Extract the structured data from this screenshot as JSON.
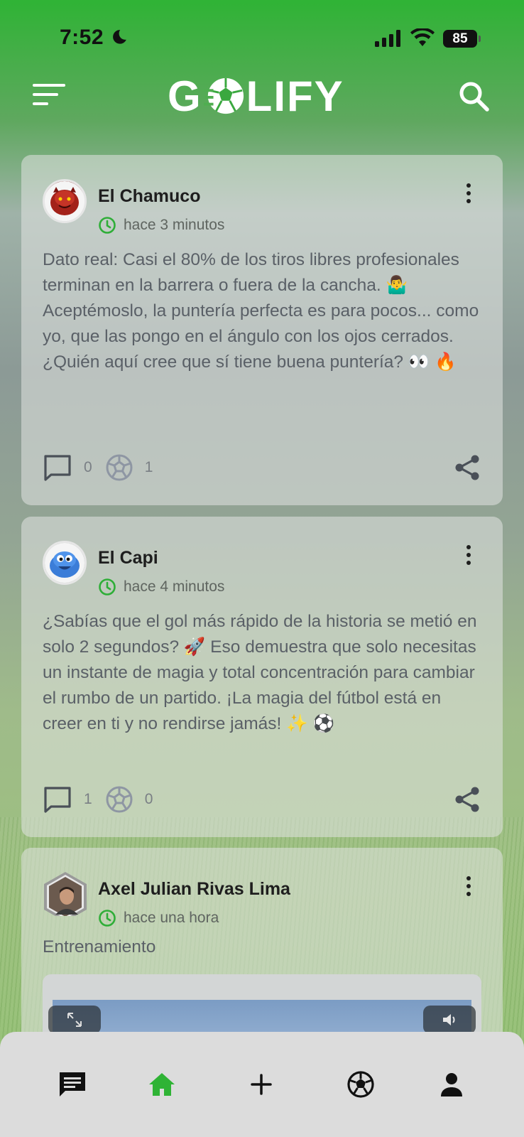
{
  "status_bar": {
    "time": "7:52",
    "battery": "85"
  },
  "app": {
    "logo_text_left": "G",
    "logo_text_right": "LIFY",
    "brand_color": "#2fb335"
  },
  "posts": [
    {
      "author": "El Chamuco",
      "time_ago": "hace 3 minutos",
      "text": "Dato real: Casi el 80% de los tiros libres profesionales terminan en la barrera o fuera de la cancha. 🤷‍♂️  Aceptémoslo, la puntería perfecta es para pocos... como yo, que las pongo en el ángulo con los ojos cerrados. ¿Quién aquí cree que sí tiene buena puntería? 👀 🔥",
      "comments": "0",
      "balls": "1"
    },
    {
      "author": "El Capi",
      "time_ago": "hace 4 minutos",
      "text": "¿Sabías que el gol más rápido de la historia se metió en solo 2 segundos? 🚀 Eso demuestra que solo necesitas un instante de magia y total concentración para cambiar el rumbo de un partido. ¡La magia del fútbol está en creer en ti y no rendirse jamás! ✨ ⚽",
      "comments": "1",
      "balls": "0"
    },
    {
      "author": "Axel Julian Rivas Lima",
      "time_ago": "hace una hora",
      "text": "Entrenamiento"
    }
  ],
  "icons": {
    "menu": "menu-icon",
    "search": "search-icon",
    "clock": "clock-icon",
    "comment": "comment-icon",
    "ball": "soccer-ball-icon",
    "share": "share-icon",
    "more": "more-vertical-icon"
  },
  "nav": [
    "chat",
    "home",
    "add",
    "soccer-ball",
    "profile"
  ]
}
